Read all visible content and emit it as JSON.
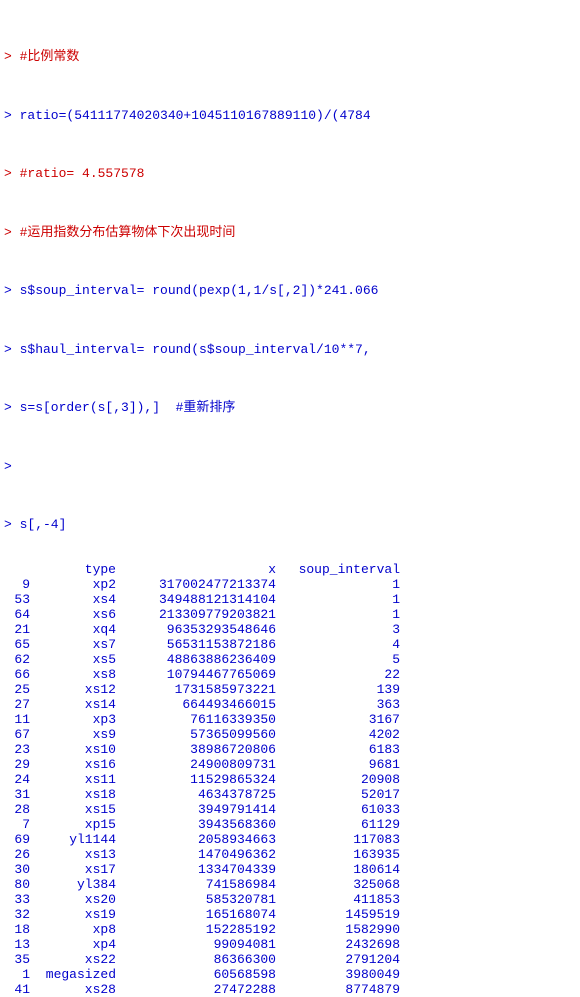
{
  "console": {
    "lines": [
      {
        "type": "comment",
        "text": "> #比例常数"
      },
      {
        "type": "code",
        "text": "> ratio=(54111774020340+1045110167889110)/(4784"
      },
      {
        "type": "comment",
        "text": "> #ratio= 4.557578"
      },
      {
        "type": "comment",
        "text": "> #运用指数分布估算物体下次出现时间"
      },
      {
        "type": "code",
        "text": "> s$soup_interval= round(pexp(1,1/s[,2])*241.066"
      },
      {
        "type": "code",
        "text": "> s$haul_interval= round(s$soup_interval/10**7,"
      },
      {
        "type": "code",
        "text": "> s=s[order(s[,3]),]  #重新排序"
      },
      {
        "type": "empty",
        "text": ">"
      },
      {
        "type": "code",
        "text": "> s[,-4]"
      }
    ],
    "table": {
      "headers": [
        "",
        "type",
        "x",
        "soup_interval"
      ],
      "rows": [
        {
          "index": "9",
          "type": "xp2",
          "x": "317002477213374",
          "soup_interval": "1"
        },
        {
          "index": "53",
          "type": "xs4",
          "x": "349488121314104",
          "soup_interval": "1"
        },
        {
          "index": "64",
          "type": "xs6",
          "x": "213309779203821",
          "soup_interval": "1"
        },
        {
          "index": "21",
          "type": "xq4",
          "x": "96353293548646",
          "soup_interval": "3"
        },
        {
          "index": "65",
          "type": "xs7",
          "x": "56531153872186",
          "soup_interval": "4"
        },
        {
          "index": "62",
          "type": "xs5",
          "x": "48863886236409",
          "soup_interval": "5"
        },
        {
          "index": "66",
          "type": "xs8",
          "x": "10794467765069",
          "soup_interval": "22"
        },
        {
          "index": "25",
          "type": "xs12",
          "x": "1731585973221",
          "soup_interval": "139"
        },
        {
          "index": "27",
          "type": "xs14",
          "x": "664493466015",
          "soup_interval": "363"
        },
        {
          "index": "11",
          "type": "xp3",
          "x": "76116339350",
          "soup_interval": "3167"
        },
        {
          "index": "67",
          "type": "xs9",
          "x": "57365099560",
          "soup_interval": "4202"
        },
        {
          "index": "23",
          "type": "xs10",
          "x": "38986720806",
          "soup_interval": "6183"
        },
        {
          "index": "29",
          "type": "xs16",
          "x": "24900809731",
          "soup_interval": "9681"
        },
        {
          "index": "24",
          "type": "xs11",
          "x": "11529865324",
          "soup_interval": "20908"
        },
        {
          "index": "31",
          "type": "xs18",
          "x": "4634378725",
          "soup_interval": "52017"
        },
        {
          "index": "28",
          "type": "xs15",
          "x": "3949791414",
          "soup_interval": "61033"
        },
        {
          "index": "7",
          "type": "xp15",
          "x": "3943568360",
          "soup_interval": "61129"
        },
        {
          "index": "69",
          "type": "yl1144",
          "x": "2058934663",
          "soup_interval": "117083"
        },
        {
          "index": "26",
          "type": "xs13",
          "x": "1470496362",
          "soup_interval": "163935"
        },
        {
          "index": "30",
          "type": "xs17",
          "x": "1334704339",
          "soup_interval": "180614"
        },
        {
          "index": "80",
          "type": "yl384",
          "x": "741586984",
          "soup_interval": "325068"
        },
        {
          "index": "33",
          "type": "xs20",
          "x": "585320781",
          "soup_interval": "411853"
        },
        {
          "index": "32",
          "type": "xs19",
          "x": "165168074",
          "soup_interval": "1459519"
        },
        {
          "index": "18",
          "type": "xp8",
          "x": "152285192",
          "soup_interval": "1582990"
        },
        {
          "index": "13",
          "type": "xp4",
          "x": "99094081",
          "soup_interval": "2432698"
        },
        {
          "index": "35",
          "type": "xs22",
          "x": "86366300",
          "soup_interval": "2791204"
        },
        {
          "index": "1",
          "type": "megasized",
          "x": "60568598",
          "soup_interval": "3980049"
        },
        {
          "index": "41",
          "type": "xs28",
          "x": "27472288",
          "soup_interval": "8774879"
        }
      ]
    }
  }
}
